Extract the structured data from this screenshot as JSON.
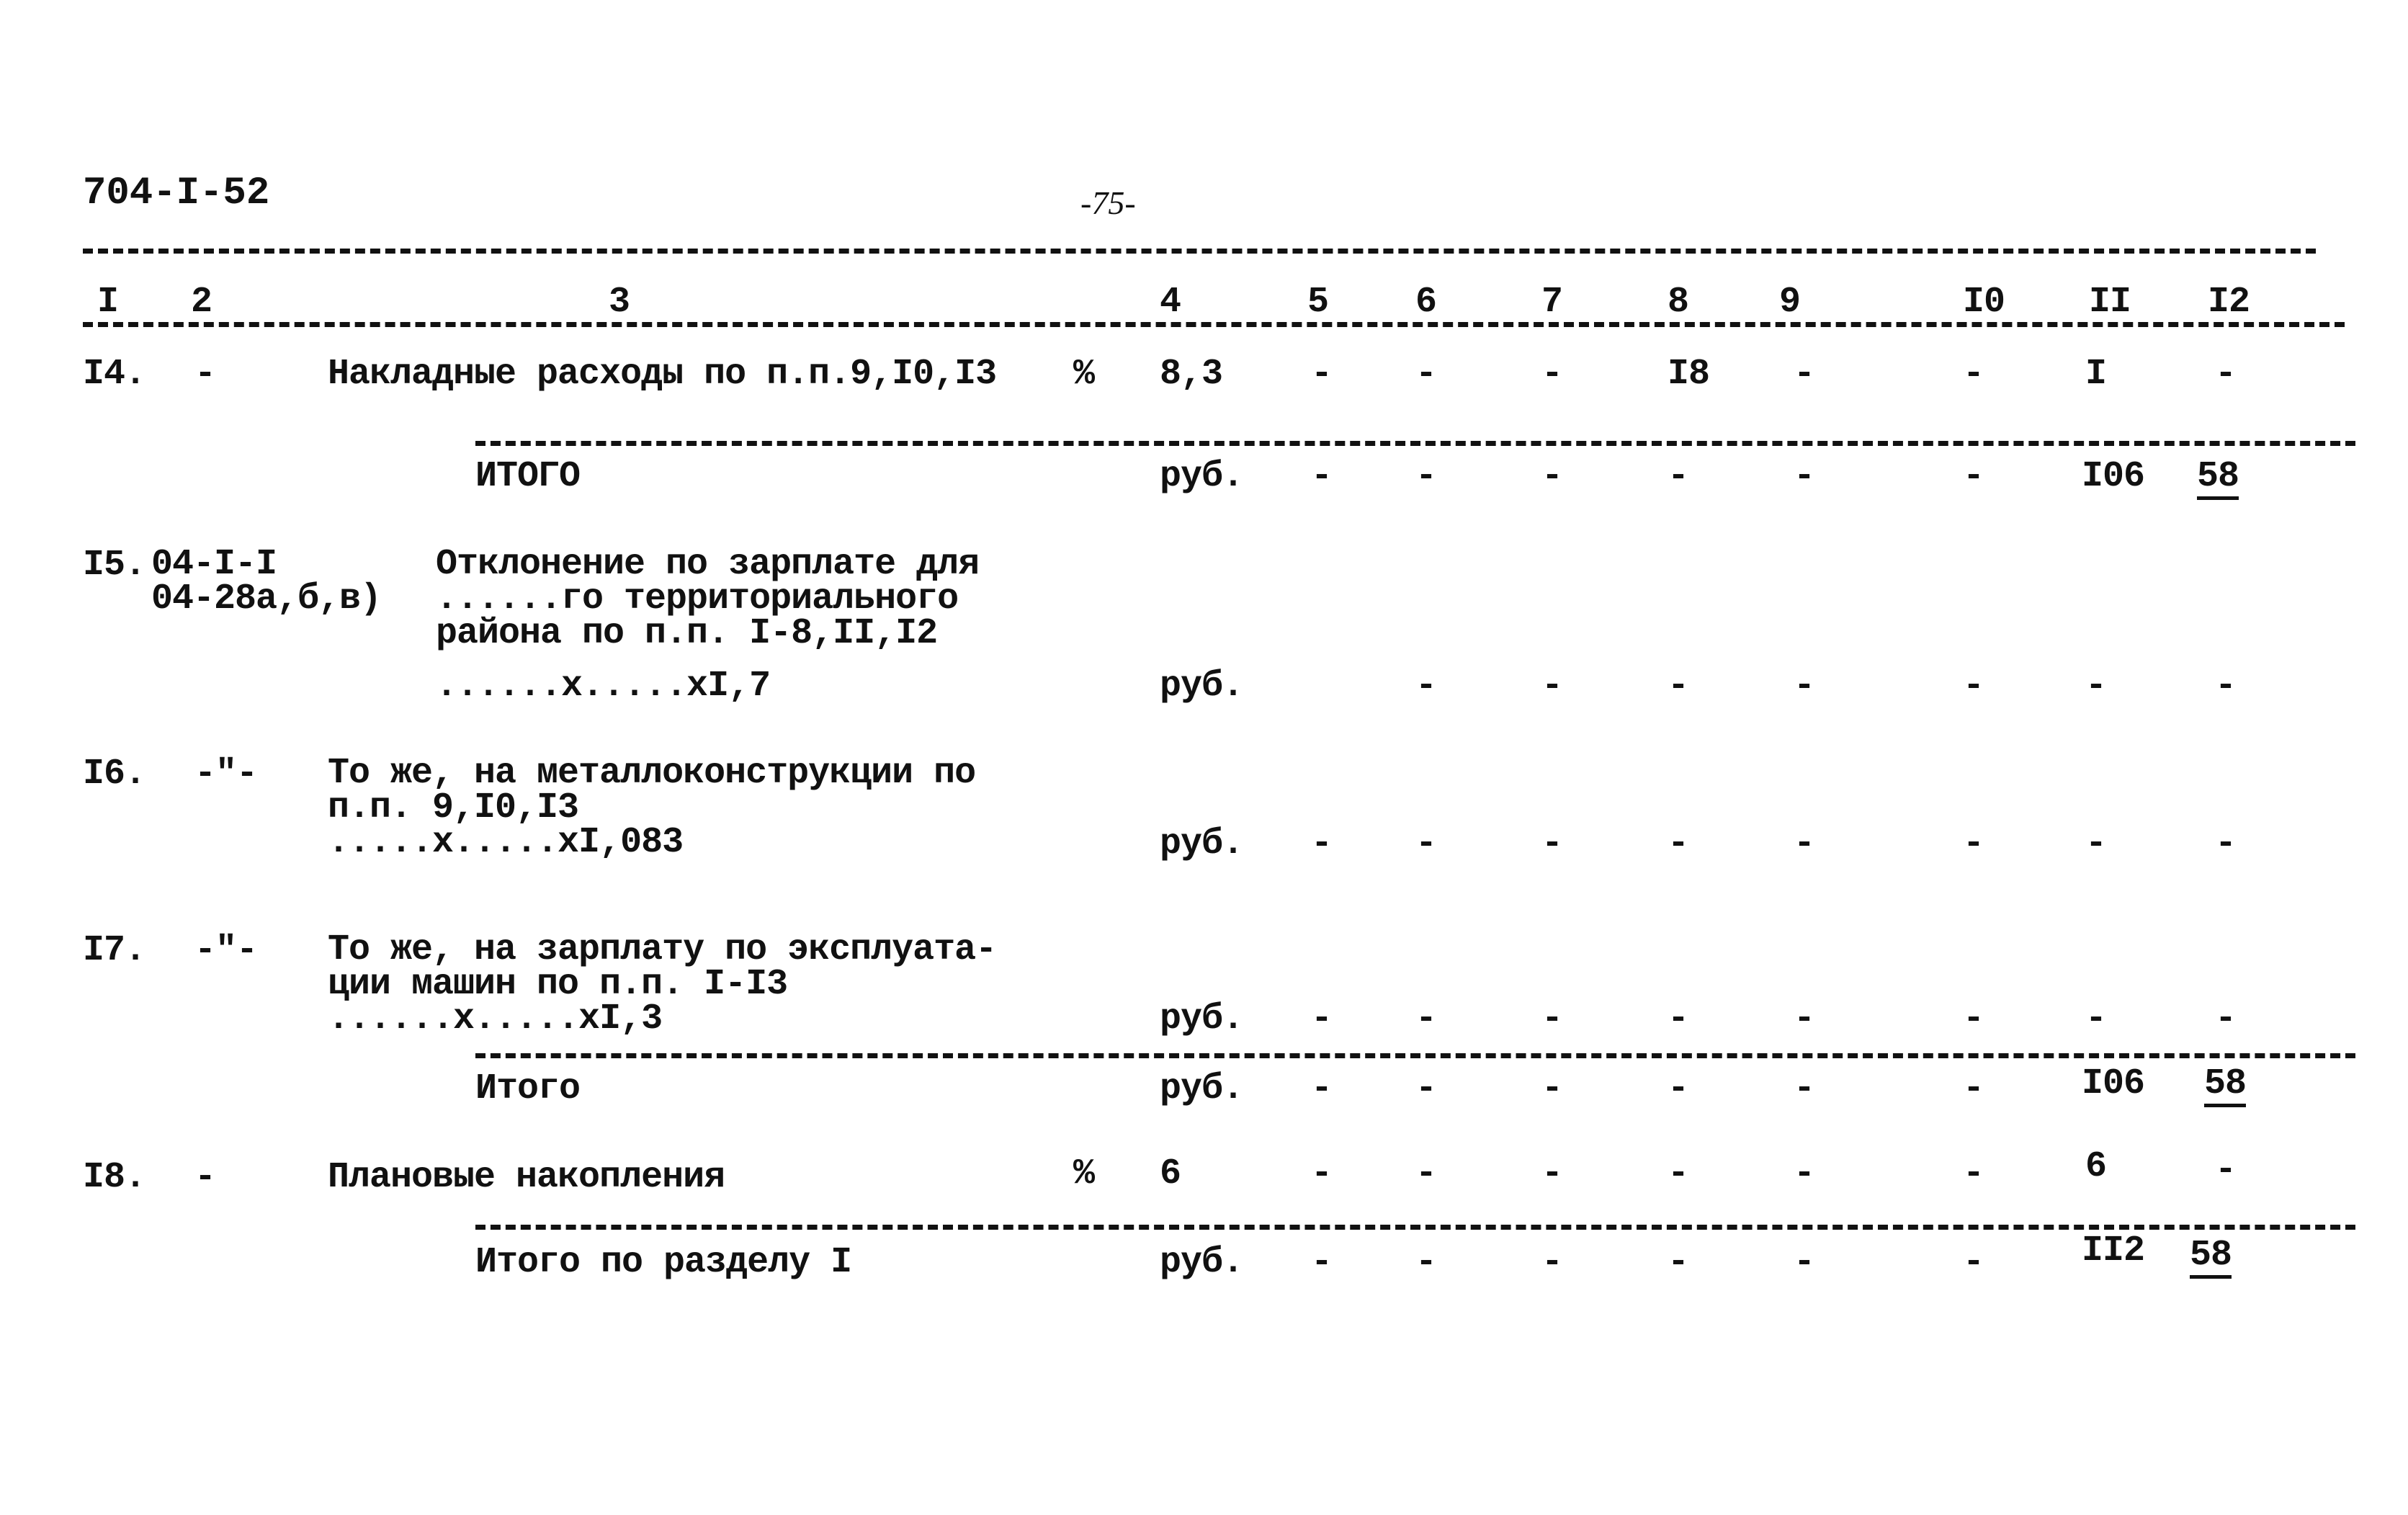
{
  "doc_code": "704-I-52",
  "page_number": "-75-",
  "column_headers": [
    "I",
    "2",
    "3",
    "4",
    "5",
    "6",
    "7",
    "8",
    "9",
    "I0",
    "II",
    "I2"
  ],
  "rows": [
    {
      "num": "I4.",
      "code": "-",
      "desc": "Накладные расходы по п.п.9,I0,I3",
      "unit": "%",
      "c4": "8,3",
      "c5": "-",
      "c6": "-",
      "c7": "-",
      "c8": "I8",
      "c9": "-",
      "c10": "-",
      "c11": "I",
      "c12": "-"
    },
    {
      "num": "",
      "code": "",
      "desc": "ИТОГО",
      "unit": "",
      "c4": "руб.",
      "c5": "-",
      "c6": "-",
      "c7": "-",
      "c8": "-",
      "c9": "-",
      "c10": "-",
      "c11": "I06",
      "c12": "58"
    },
    {
      "num": "I5.",
      "code": "04-I-I\n04-28а,б,в)",
      "desc": "Отклонение по зарплате для\n......го территориального\nрайона по п.п. I-8,II,I2",
      "desc_formula": "......х.....хI,7",
      "unit": "",
      "c4": "руб.",
      "c5": "",
      "c6": "-",
      "c7": "-",
      "c8": "-",
      "c9": "-",
      "c10": "-",
      "c11": "-",
      "c12": "-"
    },
    {
      "num": "I6.",
      "code": "-\"-",
      "desc": "То же, на металлоконструкции по\nп.п. 9,I0,I3\n.....х.....хI,083",
      "unit": "",
      "c4": "руб.",
      "c5": "-",
      "c6": "-",
      "c7": "-",
      "c8": "-",
      "c9": "-",
      "c10": "-",
      "c11": "-",
      "c12": "-"
    },
    {
      "num": "I7.",
      "code": "-\"-",
      "desc": "То же, на зарплату по эксплуата-\nции машин по п.п. I-I3\n......х.....хI,3",
      "unit": "",
      "c4": "руб.",
      "c5": "-",
      "c6": "-",
      "c7": "-",
      "c8": "-",
      "c9": "-",
      "c10": "-",
      "c11": "-",
      "c12": "-"
    },
    {
      "num": "",
      "code": "",
      "desc": "Итого",
      "unit": "",
      "c4": "руб.",
      "c5": "-",
      "c6": "-",
      "c7": "-",
      "c8": "-",
      "c9": "-",
      "c10": "-",
      "c11": "I06",
      "c12": "58"
    },
    {
      "num": "I8.",
      "code": "-",
      "desc": "Плановые накопления",
      "unit": "%",
      "c4": "6",
      "c5": "-",
      "c6": "-",
      "c7": "-",
      "c8": "-",
      "c9": "-",
      "c10": "-",
      "c11": "6",
      "c12": "-"
    },
    {
      "num": "",
      "code": "",
      "desc": "Итого по разделу I",
      "unit": "",
      "c4": "руб.",
      "c5": "-",
      "c6": "-",
      "c7": "-",
      "c8": "-",
      "c9": "-",
      "c10": "-",
      "c11": "II2",
      "c12": "58"
    }
  ]
}
